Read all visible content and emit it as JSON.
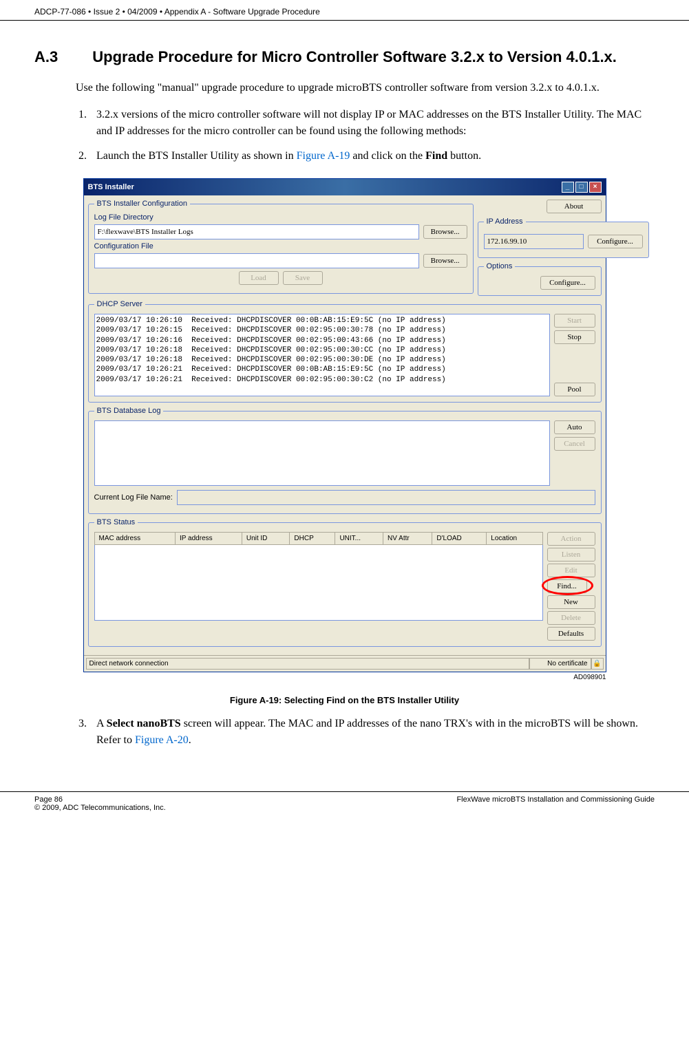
{
  "header": "ADCP-77-086 • Issue 2 • 04/2009 • Appendix A - Software Upgrade Procedure",
  "section": {
    "number": "A.3",
    "title": "Upgrade Procedure for Micro Controller Software 3.2.x to Version 4.0.1.x."
  },
  "intro_text": "Use the following \"manual\" upgrade procedure to upgrade microBTS controller software from version 3.2.x to 4.0.1.x.",
  "steps": {
    "1": "3.2.x versions of the micro controller software will not display IP or MAC addresses on the BTS Installer Utility. The MAC and IP addresses for the micro controller can be found using the following methods:",
    "2_pre": "Launch the BTS Installer Utility as shown in ",
    "2_link": "Figure A-19",
    "2_mid": " and click on the ",
    "2_bold": "Find",
    "2_post": " button.",
    "3_pre": "A ",
    "3_bold": "Select nanoBTS",
    "3_mid": " screen will appear. The MAC and IP addresses of the nano TRX's with in the microBTS will be shown. Refer to ",
    "3_link": "Figure A-20",
    "3_post": "."
  },
  "app": {
    "title": "BTS Installer",
    "config_section": "BTS Installer Configuration",
    "log_dir_label": "Log File Directory",
    "log_dir_value": "F:\\flexwave\\BTS Installer Logs",
    "config_file_label": "Configuration File",
    "config_file_value": "",
    "browse": "Browse...",
    "load": "Load",
    "save": "Save",
    "about": "About",
    "ip_label": "IP Address",
    "ip_value": "172.16.99.10",
    "configure": "Configure...",
    "options_label": "Options",
    "dhcp_section": "DHCP Server",
    "dhcp_log": "2009/03/17 10:26:10  Received: DHCPDISCOVER 00:0B:AB:15:E9:5C (no IP address)\n2009/03/17 10:26:15  Received: DHCPDISCOVER 00:02:95:00:30:78 (no IP address)\n2009/03/17 10:26:16  Received: DHCPDISCOVER 00:02:95:00:43:66 (no IP address)\n2009/03/17 10:26:18  Received: DHCPDISCOVER 00:02:95:00:30:CC (no IP address)\n2009/03/17 10:26:18  Received: DHCPDISCOVER 00:02:95:00:30:DE (no IP address)\n2009/03/17 10:26:21  Received: DHCPDISCOVER 00:0B:AB:15:E9:5C (no IP address)\n2009/03/17 10:26:21  Received: DHCPDISCOVER 00:02:95:00:30:C2 (no IP address)",
    "start": "Start",
    "stop": "Stop",
    "pool": "Pool",
    "db_section": "BTS Database Log",
    "auto": "Auto",
    "cancel": "Cancel",
    "current_log_label": "Current Log File Name:",
    "status_section": "BTS Status",
    "cols": {
      "mac": "MAC address",
      "ip": "IP address",
      "unit_id": "Unit ID",
      "dhcp": "DHCP",
      "unit": "UNIT...",
      "nv": "NV Attr",
      "dload": "D'LOAD",
      "loc": "Location"
    },
    "action": "Action",
    "listen": "Listen",
    "edit": "Edit",
    "find": "Find...",
    "new": "New",
    "delete": "Delete",
    "defaults": "Defaults",
    "status_left": "Direct network connection",
    "status_right": "No certificate"
  },
  "img_id": "AD098901",
  "figure_caption": "Figure A-19: Selecting Find on the BTS Installer Utility",
  "footer": {
    "page": "Page 86",
    "copyright": "© 2009, ADC Telecommunications, Inc.",
    "guide": "FlexWave microBTS Installation and Commissioning Guide"
  }
}
